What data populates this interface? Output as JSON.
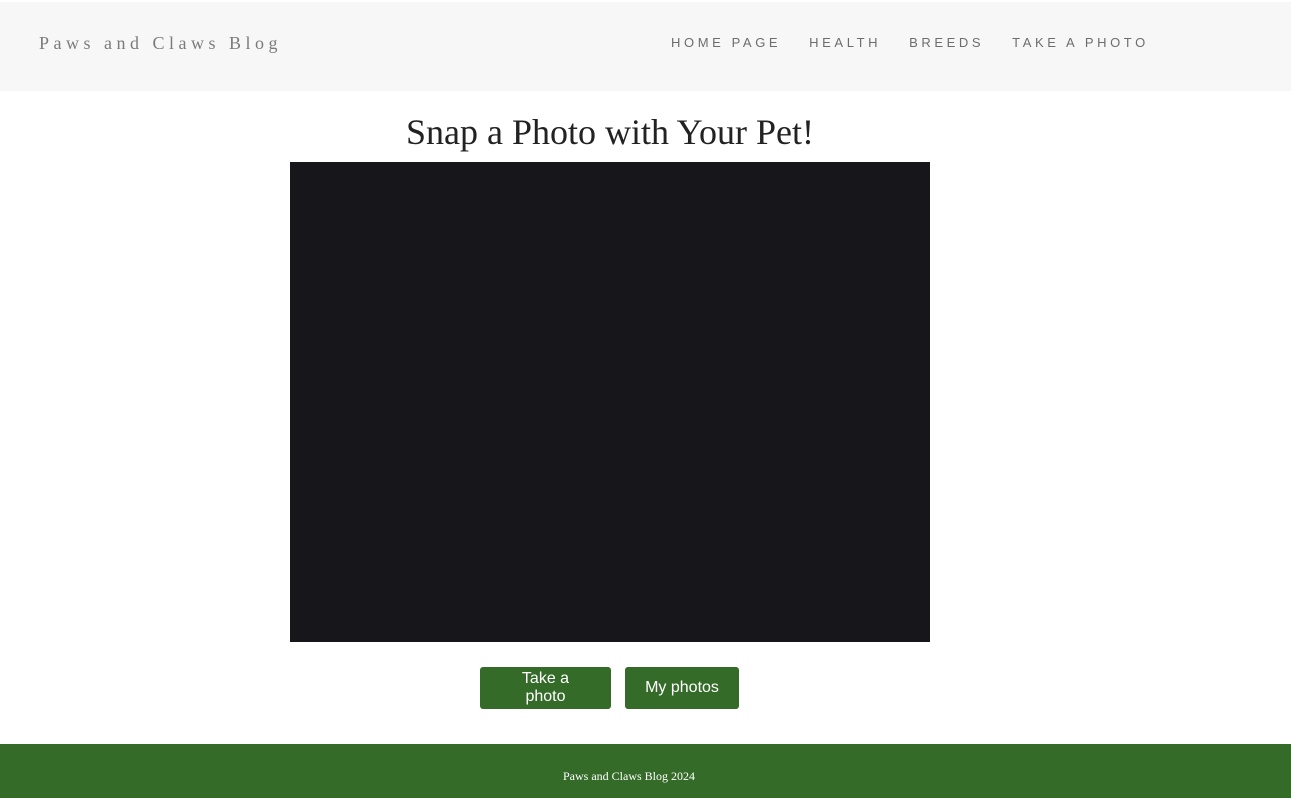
{
  "header": {
    "brand": "Paws and Claws Blog",
    "nav": [
      {
        "label": "HOME PAGE"
      },
      {
        "label": "HEALTH"
      },
      {
        "label": "BREEDS"
      },
      {
        "label": "TAKE A PHOTO"
      }
    ]
  },
  "main": {
    "title": "Snap a Photo with Your Pet!",
    "buttons": {
      "take_photo": "Take a photo",
      "my_photos": "My photos"
    }
  },
  "footer": {
    "text": "Paws and Claws Blog 2024"
  },
  "colors": {
    "header_bg": "#f7f7f7",
    "accent_green": "#346b29",
    "camera_bg": "#17161a"
  }
}
